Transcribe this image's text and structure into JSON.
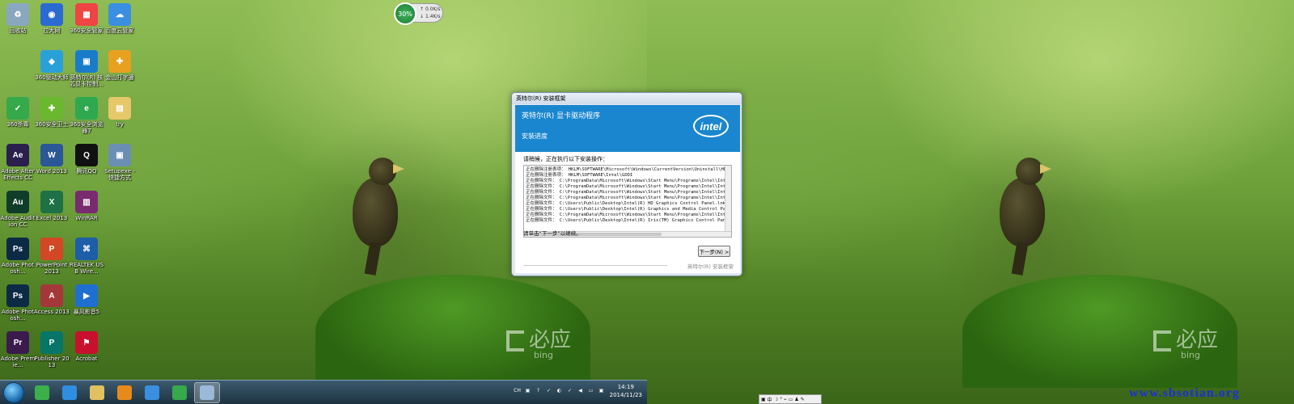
{
  "desktop_icons": [
    {
      "label": "回收站",
      "color": "#8aa7c0",
      "glyph": "♻"
    },
    {
      "label": "拉大网",
      "color": "#2b6bd1",
      "glyph": "◉"
    },
    {
      "label": "360安全管家",
      "color": "#e44",
      "glyph": "▦"
    },
    {
      "label": "百度云管家",
      "color": "#3a8fe0",
      "glyph": "☁"
    },
    {
      "label": "360驱动大师",
      "color": "#2aa0d8",
      "glyph": "◆"
    },
    {
      "label": "英特尔(R) 核芯显卡控制...",
      "color": "#1a7cc9",
      "glyph": "▣"
    },
    {
      "label": "金山打字通",
      "color": "#e8a020",
      "glyph": "✚"
    },
    {
      "label": "360杀毒",
      "color": "#36a94a",
      "glyph": "✓"
    },
    {
      "label": "360安全卫士",
      "color": "#6ab82e",
      "glyph": "✚"
    },
    {
      "label": "360安全浏览器7",
      "color": "#2fa84f",
      "glyph": "e"
    },
    {
      "label": "try",
      "color": "#e6c86a",
      "glyph": "▤"
    },
    {
      "label": "Adobe After Effects CC",
      "color": "#2a1f4d",
      "glyph": "Ae"
    },
    {
      "label": "Word 2013",
      "color": "#2b5797",
      "glyph": "W"
    },
    {
      "label": "腾讯QQ",
      "color": "#111",
      "glyph": "Q"
    },
    {
      "label": "Setupexe - 快捷方式",
      "color": "#6b8fb3",
      "glyph": "▣"
    },
    {
      "label": "Adobe Audition CC",
      "color": "#0f3d2a",
      "glyph": "Au"
    },
    {
      "label": "Excel 2013",
      "color": "#1e7145",
      "glyph": "X"
    },
    {
      "label": "WinRAR",
      "color": "#7a2a6e",
      "glyph": "▥"
    },
    {
      "label": "Adobe Photosh...",
      "color": "#0d2a45",
      "glyph": "Ps"
    },
    {
      "label": "PowerPoint 2013",
      "color": "#d24726",
      "glyph": "P"
    },
    {
      "label": "REALTEK USB Wire...",
      "color": "#1c5ea8",
      "glyph": "⌘"
    },
    {
      "label": "Adobe Photosh...",
      "color": "#0d2a45",
      "glyph": "Ps"
    },
    {
      "label": "Access 2013",
      "color": "#a4373a",
      "glyph": "A"
    },
    {
      "label": "暴风影音5",
      "color": "#1f6fd1",
      "glyph": "▶"
    },
    {
      "label": "Adobe Premie...",
      "color": "#3b1a4d",
      "glyph": "Pr"
    },
    {
      "label": "Publisher 2013",
      "color": "#077568",
      "glyph": "P"
    },
    {
      "label": "Acrobat",
      "color": "#c8102e",
      "glyph": "⚑"
    }
  ],
  "netmeter": {
    "percent": "30%",
    "up": "0.0K/s",
    "down": "1.4K/s"
  },
  "dialog": {
    "title": "英特尔(R) 安装框架",
    "product": "英特尔(R) 显卡驱动程序",
    "stage": "安装进度",
    "logo": "intel",
    "prompt": "请稍候，正在执行以下安装操作：",
    "log_lines": [
      "正在删除注册表项： HKLM\\SOFTWARE\\Microsoft\\Windows\\CurrentVersion\\Uninstall\\HDMI",
      "正在删除注册表项： HKLM\\SOFTWARE\\Intel\\GDDI",
      "正在删除文件： C:\\ProgramData\\Microsoft\\Windows\\Start Menu\\Programs\\Intel\\Intel(R) HD",
      "正在删除文件： C:\\ProgramData\\Microsoft\\Windows\\Start Menu\\Programs\\Intel\\Intel(R) HD Grap",
      "正在删除文件： C:\\ProgramData\\Microsoft\\Windows\\Start Menu\\Programs\\Intel\\Intel(R) Graphics",
      "正在删除文件： C:\\ProgramData\\Microsoft\\Windows\\Start Menu\\Programs\\Intel\\Intel(R) Gra",
      "正在删除文件： C:\\Users\\Public\\Desktop\\Intel(R) HD Graphics Control Panel.lnk",
      "正在删除文件： C:\\Users\\Public\\Desktop\\Intel(R) Graphics and Media Control Panel.lnk",
      "正在删除文件： C:\\ProgramData\\Microsoft\\Windows\\Start Menu\\Programs\\Intel\\Intel(R) Iris",
      "正在删除文件： C:\\Users\\Public\\Desktop\\Intel(R) Iris(TM) Graphics Control Panel.lnk"
    ],
    "hint": "请单击“下一步”以继续。",
    "next_button": "下一步(N) >",
    "footer": "英特尔(R) 安装框架"
  },
  "taskbar": {
    "apps": [
      {
        "name": "360-browser",
        "color": "#3bb04a"
      },
      {
        "name": "ie",
        "color": "#2f8ee0"
      },
      {
        "name": "explorer",
        "color": "#e0c060"
      },
      {
        "name": "media-player",
        "color": "#e88a1a"
      },
      {
        "name": "baidu-cloud",
        "color": "#3a8fe0"
      },
      {
        "name": "360-safe",
        "color": "#36a94a"
      },
      {
        "name": "intel-setup",
        "color": "#9bb8d8"
      }
    ],
    "tray": [
      "CH",
      "▣",
      "?",
      "✓",
      "◐",
      "✓",
      "◀",
      "▭",
      "▣"
    ],
    "time": "14:19",
    "date": "2014/11/23"
  },
  "ime_bar": [
    "▣",
    "中",
    "☽",
    "°",
    "⌁",
    "▭",
    "♟",
    "✎"
  ],
  "bing_watermark": {
    "cn": "必应",
    "en": "bing"
  },
  "site_url": "www.sbsotian.org"
}
